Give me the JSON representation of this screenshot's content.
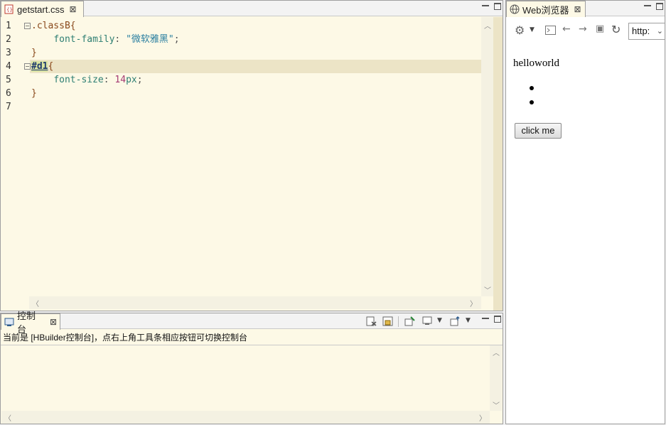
{
  "editor": {
    "tab_title": "getstart.css",
    "lines": [
      {
        "num": "1",
        "selector": ".classB",
        "rest": "{"
      },
      {
        "num": "2",
        "indent": "    ",
        "property": "font-family",
        "colon": ": ",
        "string": "\"微软雅黑\"",
        "end": ";"
      },
      {
        "num": "3",
        "text": "}"
      },
      {
        "num": "4",
        "id_selector": "#d1",
        "rest": "{"
      },
      {
        "num": "5",
        "indent": "    ",
        "property": "font-size",
        "colon": ": ",
        "number": "14",
        "unit": "px",
        "end": ";"
      },
      {
        "num": "6",
        "text": "}"
      },
      {
        "num": "7",
        "text": ""
      }
    ]
  },
  "console": {
    "tab_title": "控制台",
    "message": "当前是 [HBuilder控制台]，点右上角工具条相应按钮可切换控制台"
  },
  "browser": {
    "tab_title": "Web浏览器",
    "url": "http:",
    "heading": "helloworld",
    "button_label": "click me"
  },
  "icons": {
    "close": "close-icon",
    "minimize": "minimize-icon",
    "maximize": "maximize-icon"
  },
  "colors": {
    "editor_bg": "#fdf9e6",
    "current_line": "#ece4c6",
    "selector": "#8a4a1c",
    "property": "#2e7f73",
    "string": "#2a7fa0",
    "number": "#a53b73"
  }
}
